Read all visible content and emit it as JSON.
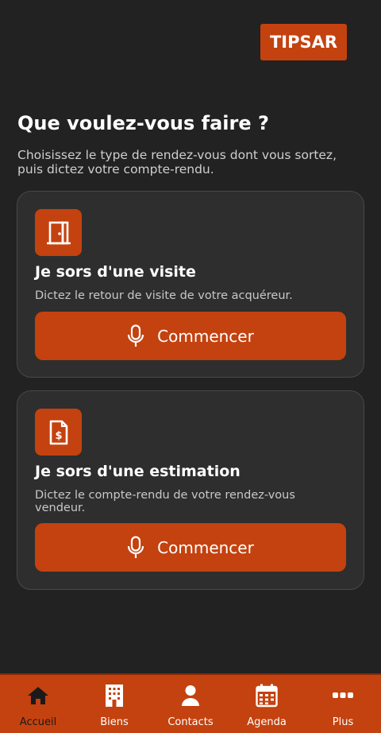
{
  "brand": {
    "logo_text": "TIPSAR",
    "accent": "#c4420f"
  },
  "header": {
    "title": "Que voulez-vous faire ?",
    "subtitle": "Choisissez le type de rendez-vous dont vous sortez, puis dictez votre compte-rendu."
  },
  "cards": [
    {
      "icon": "door-icon",
      "title": "Je sors d'une visite",
      "description": "Dictez le retour de visite de votre acquéreur.",
      "button_label": "Commencer"
    },
    {
      "icon": "invoice-icon",
      "title": "Je sors d'une estimation",
      "description": "Dictez le compte-rendu de votre rendez-vous vendeur.",
      "button_label": "Commencer"
    }
  ],
  "nav": {
    "active": "Accueil",
    "items": [
      {
        "label": "Accueil",
        "icon": "home-icon"
      },
      {
        "label": "Biens",
        "icon": "building-icon"
      },
      {
        "label": "Contacts",
        "icon": "user-icon"
      },
      {
        "label": "Agenda",
        "icon": "calendar-icon"
      },
      {
        "label": "Plus",
        "icon": "more-icon"
      }
    ]
  }
}
